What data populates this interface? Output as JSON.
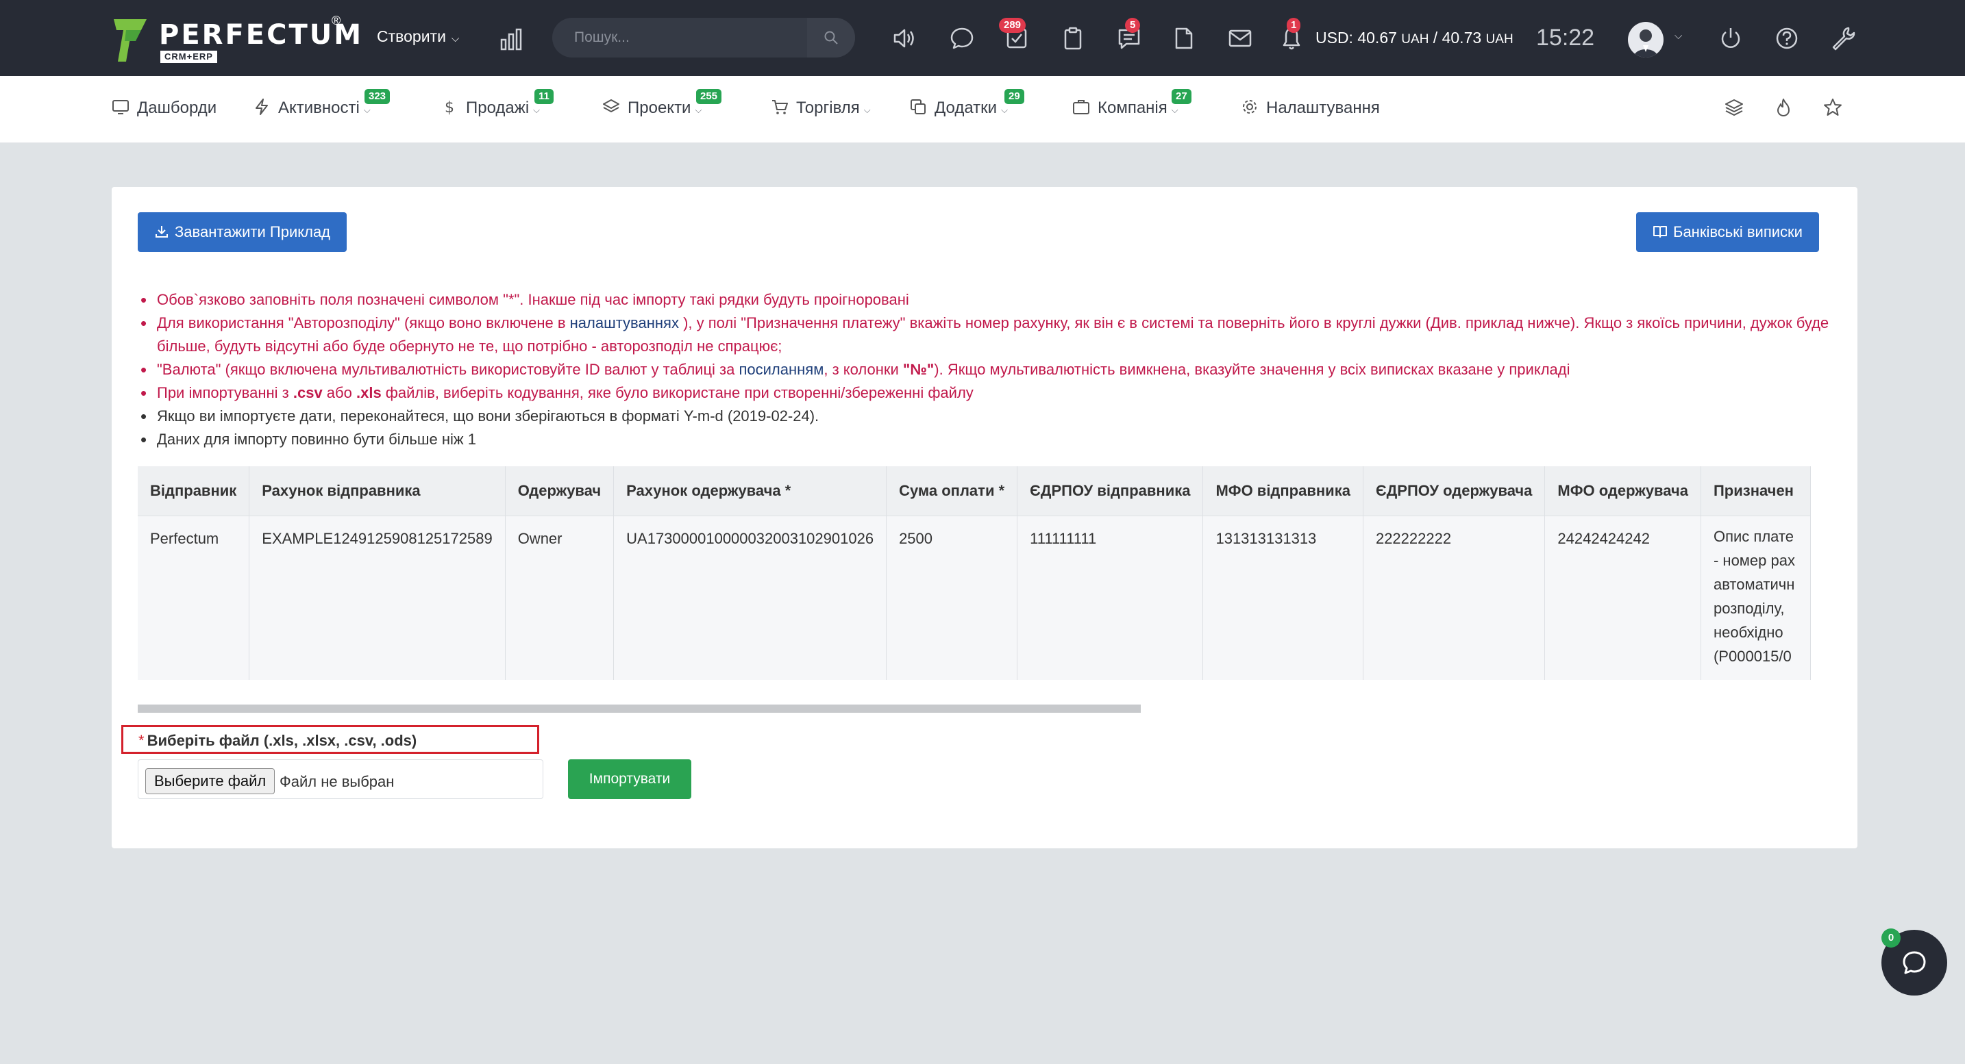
{
  "header": {
    "logo_text": "PERFECTUM",
    "logo_sub": "CRM+ERP",
    "create_label": "Створити",
    "search_placeholder": "Пошук...",
    "badges": {
      "tasks": "289",
      "chat": "5",
      "notifications": "1"
    },
    "currency_usd": "USD: 40.67",
    "currency_uah1": "UAH",
    "currency_sep": " / 40.73 ",
    "currency_uah2": "UAH",
    "clock": "15:22"
  },
  "nav": {
    "items": [
      {
        "label": "Дашборди",
        "badge": ""
      },
      {
        "label": "Активності",
        "badge": "323"
      },
      {
        "label": "Продажі",
        "badge": "11"
      },
      {
        "label": "Проекти",
        "badge": "255"
      },
      {
        "label": "Торгівля",
        "badge": ""
      },
      {
        "label": "Додатки",
        "badge": "29"
      },
      {
        "label": "Компанія",
        "badge": "27"
      },
      {
        "label": "Налаштування",
        "badge": ""
      }
    ]
  },
  "page": {
    "download_example": "Завантажити Приклад",
    "bank_statements": "Банківські виписки",
    "notes": {
      "n1": "Обов`язково заповніть поля позначені символом \"*\". Інакше під час імпорту такі рядки будуть проігноровані",
      "n2a": "Для використання \"Авторозподілу\" (якщо воно включене в ",
      "n2_link": "налаштуваннях",
      "n2b": " ), у полі \"Призначення платежу\" вкажіть номер рахунку, як він є в системі та поверніть його в круглі дужки (Див. приклад нижче). Якщо з якоїсь причини, дужок буде більше, будуть відсутні або буде обернуто не те, що потрібно - авторозподіл не спрацює;",
      "n3a": "\"Валюта\" (якщо включена мультивалютність використовуйте ID валют у таблиці за ",
      "n3_link": "посиланням",
      "n3b": ", з колонки ",
      "n3_bold": "\"№\"",
      "n3c": "). Якщо мультивалютність вимкнена, вказуйте значення у всіх виписках вказане у прикладі",
      "n4a": "При імпортуванні з ",
      "n4_csv": ".csv",
      "n4b": " або ",
      "n4_xls": ".xls",
      "n4c": " файлів, виберіть кодування, яке було використане при створенні/збереженні файлу",
      "n5": "Якщо ви імпортуєте дати, переконайтеся, що вони зберігаються в форматі Y-m-d (2019-02-24).",
      "n6": "Даних для імпорту повинно бути більше ніж 1"
    },
    "table": {
      "headers": [
        "Відправник",
        "Рахунок відправника",
        "Одержувач",
        "Рахунок одержувача *",
        "Сума оплати *",
        "ЄДРПОУ відправника",
        "МФО відправника",
        "ЄДРПОУ одержувача",
        "МФО одержувача",
        "Призначен"
      ],
      "row": [
        "Perfectum",
        "EXAMPLE1249125908125172589",
        "Owner",
        "UA173000010000032003102901026",
        "2500",
        "111111111",
        "131313131313",
        "222222222",
        "24242424242",
        "Опис плате - номер рах автоматичн розподілу, необхідно (P000015/0"
      ]
    },
    "file_label_star": "*",
    "file_label": "Виберіть файл (.xls, .xlsx, .csv, .ods)",
    "file_button": "Выберите файл",
    "file_status": "Файл не выбран",
    "import_button": "Імпортувати"
  },
  "chat": {
    "badge": "0"
  }
}
